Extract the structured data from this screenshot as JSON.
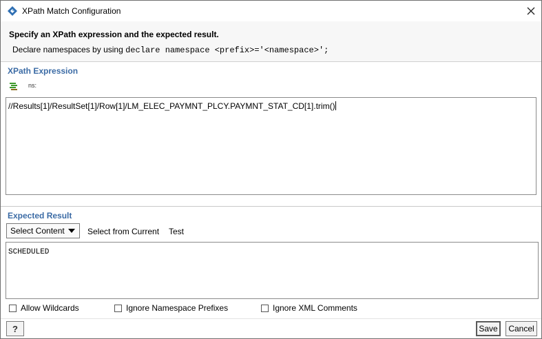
{
  "window": {
    "title": "XPath Match Configuration"
  },
  "header": {
    "heading": "Specify an XPath expression and the expected result.",
    "desc_prefix": "Declare namespaces by using ",
    "desc_code": "declare namespace <prefix>='<namespace>';"
  },
  "xpath": {
    "section_title": "XPath Expression",
    "ns_label": "ns:",
    "expression": "//Results[1]/ResultSet[1]/Row[1]/LM_ELEC_PAYMNT_PLCY.PAYMNT_STAT_CD[1].trim()"
  },
  "expected": {
    "section_title": "Expected Result",
    "select_label": "Select Content",
    "select_current_label": "Select from Current",
    "test_label": "Test",
    "value": "SCHEDULED"
  },
  "options": {
    "allow_wildcards": "Allow Wildcards",
    "ignore_ns_prefixes": "Ignore Namespace Prefixes",
    "ignore_xml_comments": "Ignore XML Comments"
  },
  "footer": {
    "help_label": "?",
    "save_label": "Save",
    "cancel_label": "Cancel"
  },
  "colors": {
    "section_title": "#3b6ba5",
    "app_icon": "#2f6fb3",
    "ns_icon": "#3d9a2c"
  }
}
